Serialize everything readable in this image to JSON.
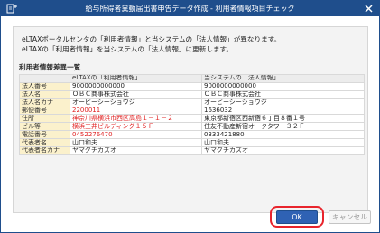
{
  "window": {
    "title": "給与所得者異動届出書申告データ作成 - 利用者情報項目チェック"
  },
  "message": {
    "line1": "eLTAXポータルセンタの「利用者情報」と当システムの「法人情報」が異なります。",
    "line2": "eLTAXの「利用者情報」を当システムの「法人情報」に更新します。"
  },
  "diff_section": {
    "label": "利用者情報差異一覧",
    "headers": [
      "",
      "eLTAXの「利用者情報」",
      "当システムの「法人情報」"
    ],
    "rows": [
      {
        "label": "法人番号",
        "eltax": "9000000000000",
        "system": "9000000000000",
        "differs": false
      },
      {
        "label": "法人名",
        "eltax": "ＯＢＣ商事株式会社",
        "system": "ＯＢＣ商事株式会社",
        "differs": false
      },
      {
        "label": "法人名カナ",
        "eltax": "オービーシーショウジ",
        "system": "オービーシーショウジ",
        "differs": false
      },
      {
        "label": "郵便番号",
        "eltax": "2200011",
        "system": "1636032",
        "differs": true
      },
      {
        "label": "住所",
        "eltax": "神奈川県横浜市西区高島１－１－２",
        "system": "東京都新宿区西新宿６丁目８番１号",
        "differs": true
      },
      {
        "label": "ビル等",
        "eltax": "横浜三井ビルディング１５Ｆ",
        "system": "住友不動産新宿オークタワー３２Ｆ",
        "differs": true
      },
      {
        "label": "電話番号",
        "eltax": "0452276470",
        "system": "0333421880",
        "differs": true
      },
      {
        "label": "代表者名",
        "eltax": "山口和夫",
        "system": "山口和夫",
        "differs": false
      },
      {
        "label": "代表者名カナ",
        "eltax": "ヤマグチカズオ",
        "system": "ヤマグチカズオ",
        "differs": false
      }
    ]
  },
  "buttons": {
    "ok": "OK",
    "cancel": "キャンセル"
  },
  "colors": {
    "titlebar": "#1f4e8c",
    "diff_text": "#e02020",
    "row_header_bg": "#fbf1cc",
    "ok_highlight": "#e8242c"
  },
  "icons": {
    "title": "document-add-icon",
    "close": "close-icon"
  }
}
